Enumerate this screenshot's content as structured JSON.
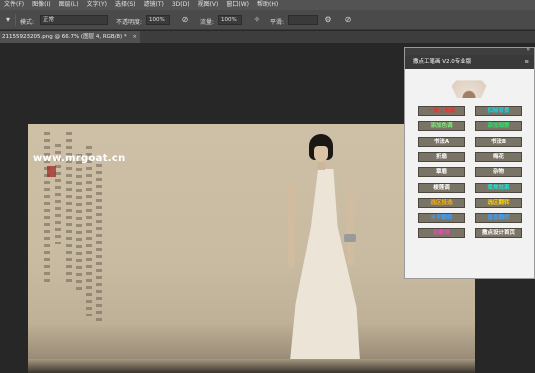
{
  "menubar": {
    "items": [
      "文件(F)",
      "图像(I)",
      "图层(L)",
      "文字(Y)",
      "选择(S)",
      "滤镜(T)",
      "3D(D)",
      "视图(V)",
      "窗口(W)",
      "帮助(H)"
    ]
  },
  "options": {
    "mode_label": "模式:",
    "mode_value": "正常",
    "opacity_label": "不透明度:",
    "opacity_value": "100%",
    "flow_label": "流量:",
    "flow_value": "100%",
    "smooth_label": "平滑:",
    "smooth_value": ""
  },
  "tab": {
    "title": "21155923205.png @ 66.7% (图层 4, RGB/8) *",
    "close": "×"
  },
  "canvas": {
    "watermark": "www.mrgoat.cn"
  },
  "panel": {
    "title": "撒点工笔画 V2.0专业版",
    "buttons": [
      {
        "label": "一键工笔画",
        "color": "#ff2a2a"
      },
      {
        "label": "扣除背景",
        "color": "#19d6e8"
      },
      {
        "label": "添加色调",
        "color": "#7ef07a"
      },
      {
        "label": "添加烟雾",
        "color": "#29e06a"
      },
      {
        "label": "书法A",
        "color": "#ffffff"
      },
      {
        "label": "书法B",
        "color": "#ffffff"
      },
      {
        "label": "折扇",
        "color": "#ffffff"
      },
      {
        "label": "梅花",
        "color": "#ffffff"
      },
      {
        "label": "章眉",
        "color": "#ffffff"
      },
      {
        "label": "杂物",
        "color": "#ffffff"
      },
      {
        "label": "棱莲调",
        "color": "#ffffff"
      },
      {
        "label": "柔焦效果",
        "color": "#16e0d2"
      },
      {
        "label": "选区投选",
        "color": "#ffb000"
      },
      {
        "label": "选区翻转",
        "color": "#ffd000"
      },
      {
        "label": "水平翻转",
        "color": "#3aa0ff"
      },
      {
        "label": "垂直翻转",
        "color": "#3aa0ff"
      },
      {
        "label": "远航特",
        "color": "#ff40c0"
      },
      {
        "label": "撒点设计首页",
        "color": "#ffffff"
      }
    ]
  }
}
